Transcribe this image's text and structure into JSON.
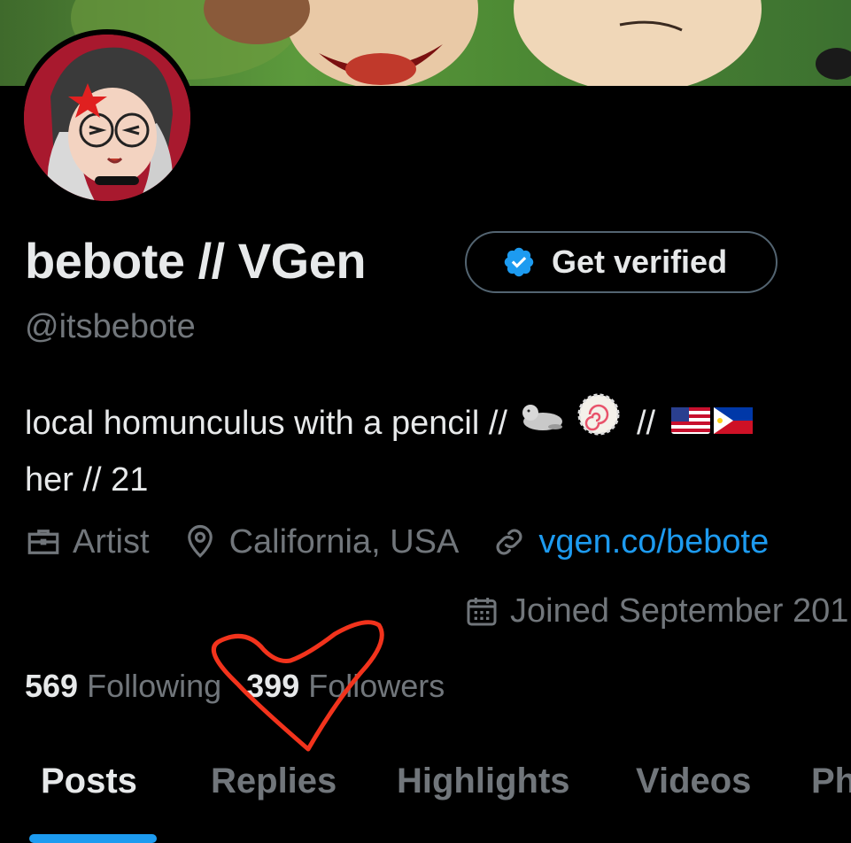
{
  "profile": {
    "display_name": "bebote // VGen",
    "handle": "@itsbebote",
    "get_verified_label": "Get verified",
    "bio_line1": "local homunculus with a pencil //",
    "bio_sep": "//",
    "bio_line2": "her // 21",
    "bio_emojis": [
      "seal",
      "fish-cake",
      "flag-us",
      "flag-ph"
    ]
  },
  "meta": {
    "profession": "Artist",
    "location": "California, USA",
    "website": "vgen.co/bebote",
    "joined": "Joined September 201"
  },
  "stats": {
    "following_count": "569",
    "following_label": "Following",
    "followers_count": "399",
    "followers_label": "Followers"
  },
  "tabs": [
    {
      "label": "Posts",
      "active": true
    },
    {
      "label": "Replies",
      "active": false
    },
    {
      "label": "Highlights",
      "active": false
    },
    {
      "label": "Videos",
      "active": false
    },
    {
      "label": "Ph",
      "active": false
    }
  ],
  "colors": {
    "accent": "#1d9bf0",
    "muted": "#71767b",
    "text": "#e7e9ea",
    "annotation": "#f2331c"
  },
  "icons": [
    "briefcase-icon",
    "location-pin-icon",
    "link-icon",
    "calendar-icon",
    "verified-badge-icon"
  ]
}
